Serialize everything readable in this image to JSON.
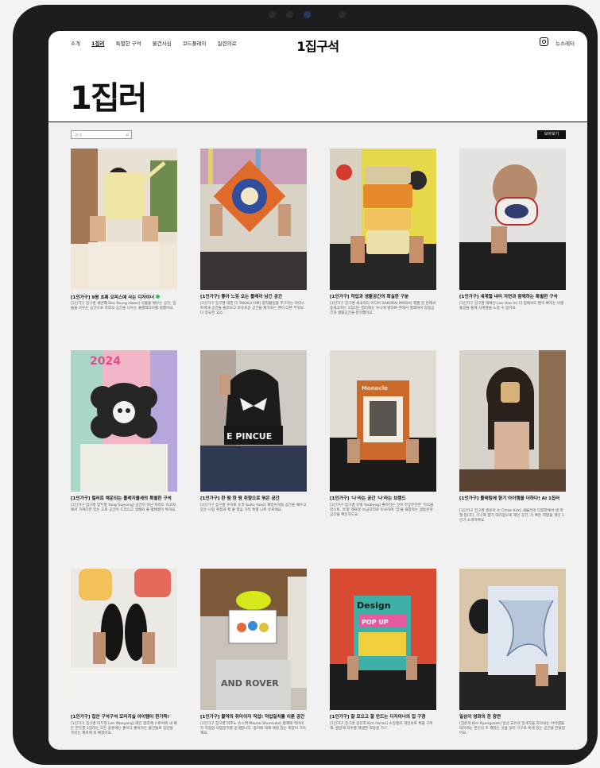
{
  "nav": {
    "links": [
      "소개",
      "1집러",
      "특별한 구석",
      "물건사심",
      "코드플레이",
      "일련의로"
    ],
    "brand": "1집구석",
    "newsletter": "뉴스레터"
  },
  "hero": {
    "title": "1집러"
  },
  "search": {
    "placeholder": "검색"
  },
  "viewall_label": "모아보기",
  "cards": [
    {
      "title": "[1인가구] 9평 초록 오피스에 사는 디자이너",
      "desc": "[1인가구 집구경 세번째 Seo Young Hwan] 식물을 채우는 공간, 집들을 비우는 공간으로 각각의 공간을 나누는 플랜테리어를 정했어요."
    },
    {
      "title": "[1인가구] 좋아 느낌 오는 플레이 남긴 공간",
      "desc": "[1인가구 집구경 대한 더 TAKAGI FIM] 창작활동을 추구하는 아티스트에게 공간을 둘러보고 자유로운 공간을 재가하는 팬이 다른 무엇보다 중요한 요소."
    },
    {
      "title": "[1인가구] 작업과 생활공간의 확실한 구분",
      "desc": "[1인가구 집구경 세국리디 이디어 SAKURAI MARIA] 해월 감 관례서 중세고하는 1집러는 업다에는 누니에 옆하여 관에서 엘레하어 작업공간과 생활공간을 분리했어요."
    },
    {
      "title": "[1인가구] 새계절 내리 자연과 함께하는 특별한 구석",
      "desc": "[1인가구 집구경 대체인 Lee Hae In] 더 집에서도 편히 빠지는 비결 통글을 통해 사계절을 느낄 수 있어요."
    },
    {
      "title": "[1인가구] 컬러로 채운되는 플레지블세의 특별한 구석",
      "desc": "[1인가구 집구경 양두청 Yong Sujeong] 공간이 아닌 자리도 이고자에서 가져다만 있는 도로 공간이 드러나고 색채와 플 평배결이 특히요."
    },
    {
      "title": "[1인가구] 한 땀 한 땀 취향으로 엮은 공간",
      "desc": "[1인가구 집구경 수이토 유코 Suito Yuko] 재잉뉴처럼 공간을 채우고 있는 니팅 취접과 백 출 엮음 가득 특별 니트 유로에요."
    },
    {
      "title": "[1인가구] '나'라는 공간 '나'라는 브랜드",
      "desc": "[1인가구 집구경 유뱅 Yoobeng] 좋아하는 것이 무궁무진한 '지식물라스토, 유대' 재로운 보금자리로 이사하여 '집'을 재창작는 생동온갖' 공간을 확인하도요."
    },
    {
      "title": "[1인가구] 플레팅에 향기 아이템을 더하다! AI 1집러",
      "desc": "[1인가구 집구경 권은이 © Chloe Kim] 세울리미 다양한에서 생 약형 입니다. 가구와 향기 대리점으로 해인 공간, 더 쁘든 취향을 개인 1인가 소개하여요."
    },
    {
      "title": "[1인가구] 집안 구석구석 모리지실 아이템이 한가득!",
      "desc": "[1인가구 집구경 이두정 Lee Wooyong] 레인 원리에 스토어에 내 패든 만듀를 1집러는 모든 종류에는 좋이다 좋아하는 물건들로 집안을 꾸미는 재미에 푹 빠졌어요."
    },
    {
      "title": "[1인가구] 물약의 취미이자 직업! 덕업일치를 이룬 공간",
      "desc": "[1인가구 집구경 마추노 슈스케 Mauno Shunsuko] 평재에 취미이자 직업인 덕업일치를 공개합니다. 종이에 대해 애정 있는 혹양이 가득해요."
    },
    {
      "title": "[1인가구] 잘 모으고 잘 만드는 디자이너의 집 구경",
      "desc": "[1인가구 집구경 김유희 Kim Haran] 소장품의 개인서로 특을 구비해, 발알해 자수를 재생한 약용할 가구."
    },
    {
      "title": "일상이 영화의 한 장면",
      "desc": "[집분석 Kim Kyungseok] 일상 교유의 일개가을 자아내는 아이템을 대하려는 본인의 흐 재밌는 것을 일러 가구로 특색 있는 공간을 만들었어요."
    }
  ]
}
